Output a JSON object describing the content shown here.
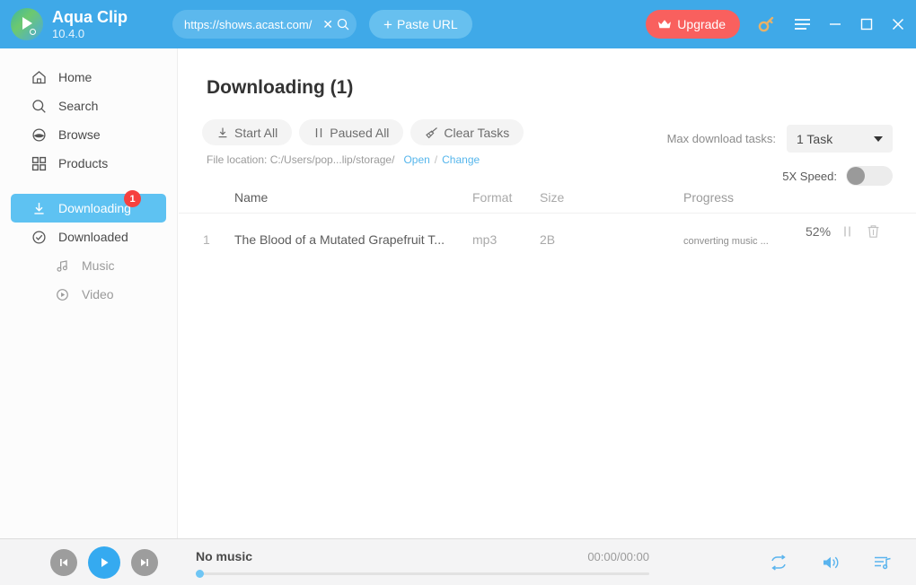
{
  "titlebar": {
    "logo_icon": "play-circle-logo",
    "app_name": "Aqua Clip",
    "version": "10.4.0",
    "url_value": "https://shows.acast.com/",
    "url_clear_icon": "close-icon",
    "url_search_icon": "search-icon",
    "paste_plus": "+",
    "paste_label": "Paste URL",
    "upgrade_label": "Upgrade",
    "upgrade_icon": "crown-icon",
    "key_icon": "key-icon",
    "menu_icon": "hamburger-menu-icon",
    "minimize_icon": "minimize-icon",
    "maximize_icon": "maximize-icon",
    "close_icon": "close-icon",
    "accent_blue": "#3fa9e8",
    "upgrade_color": "#f9605e"
  },
  "sidebar": {
    "items": [
      {
        "label": "Home",
        "icon": "home-icon"
      },
      {
        "label": "Search",
        "icon": "search-icon"
      },
      {
        "label": "Browse",
        "icon": "compass-icon"
      },
      {
        "label": "Products",
        "icon": "grid-icon"
      }
    ],
    "downloading": {
      "label": "Downloading",
      "icon": "download-icon",
      "badge": "1",
      "active": true
    },
    "downloaded": {
      "label": "Downloaded",
      "icon": "check-circle-icon"
    },
    "sub_items": [
      {
        "label": "Music",
        "icon": "music-note-icon"
      },
      {
        "label": "Video",
        "icon": "play-circle-icon"
      }
    ],
    "active_color": "#5ec2f2",
    "badge_color": "#f5413f"
  },
  "main": {
    "title": "Downloading (1)",
    "toolbar": [
      {
        "label": "Start All",
        "icon": "download-arrow-icon"
      },
      {
        "label": "Paused All",
        "icon": "pause-icon"
      },
      {
        "label": "Clear Tasks",
        "icon": "broom-icon"
      }
    ],
    "file_location": {
      "label": "File location: C:/Users/pop...lip/storage/",
      "open_link": "Open",
      "separator": "/",
      "change_link": "Change"
    },
    "max_tasks": {
      "label": "Max download tasks:",
      "value": "1 Task",
      "caret_icon": "chevron-down-icon"
    },
    "speed": {
      "label": "5X Speed:",
      "enabled": false
    },
    "table": {
      "columns": [
        "Name",
        "Format",
        "Size",
        "Progress"
      ],
      "rows": [
        {
          "index": "1",
          "name": "The Blood of a Mutated Grapefruit  T...",
          "format": "mp3",
          "size": "2B",
          "percent": "52%",
          "percent_value": 52,
          "status": "converting music ...",
          "pause_icon": "pause-icon",
          "delete_icon": "trash-icon"
        }
      ]
    }
  },
  "player": {
    "prev_icon": "skip-previous-icon",
    "play_icon": "play-icon",
    "next_icon": "skip-next-icon",
    "track_title": "No music",
    "time": "00:00/00:00",
    "repeat_icon": "repeat-icon",
    "volume_icon": "volume-icon",
    "playlist_icon": "playlist-icon",
    "progress_value": 0
  }
}
